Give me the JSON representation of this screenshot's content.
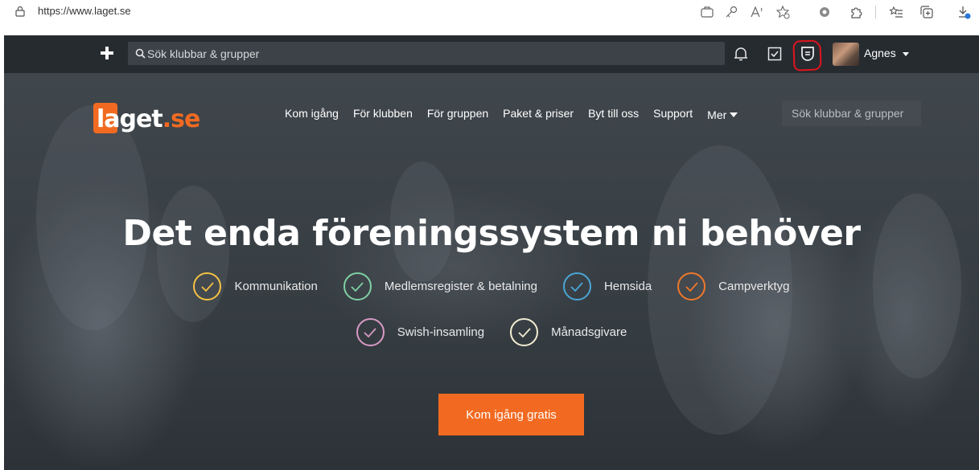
{
  "browser": {
    "url": "https://www.laget.se",
    "icons": [
      "lock-icon",
      "tab-icon",
      "key-icon",
      "read-aloud-icon",
      "favorite-add-icon",
      "extension-icon",
      "extensions-icon",
      "favorites-icon",
      "collections-icon",
      "downloads-icon"
    ]
  },
  "toolbar": {
    "search_placeholder": "Sök klubbar & grupper",
    "user_name": "Agnes",
    "icons": [
      "plus-icon",
      "search-icon",
      "bell-icon",
      "checkbox-icon",
      "shield-icon",
      "avatar",
      "caret-down-icon"
    ],
    "highlight_color": "#e0141c"
  },
  "hero": {
    "logo": {
      "part1": "laget",
      "part2": ".se"
    },
    "nav": [
      "Kom igång",
      "För klubben",
      "För gruppen",
      "Paket & priser",
      "Byt till oss",
      "Support",
      "Mer"
    ],
    "search_placeholder": "Sök klubbar & grupper",
    "headline": "Det enda föreningssystem ni behöver",
    "features_row1": [
      {
        "label": "Kommunikation",
        "color": "#f5c242"
      },
      {
        "label": "Medlemsregister & betalning",
        "color": "#7fd0a4"
      },
      {
        "label": "Hemsida",
        "color": "#4aa6d6"
      },
      {
        "label": "Campverktyg",
        "color": "#f0782a"
      }
    ],
    "features_row2": [
      {
        "label": "Swish-insamling",
        "color": "#d99ac6"
      },
      {
        "label": "Månadsgivare",
        "color": "#f2ecd2"
      }
    ],
    "cta_label": "Kom igång gratis",
    "accent_color": "#f26a21"
  }
}
